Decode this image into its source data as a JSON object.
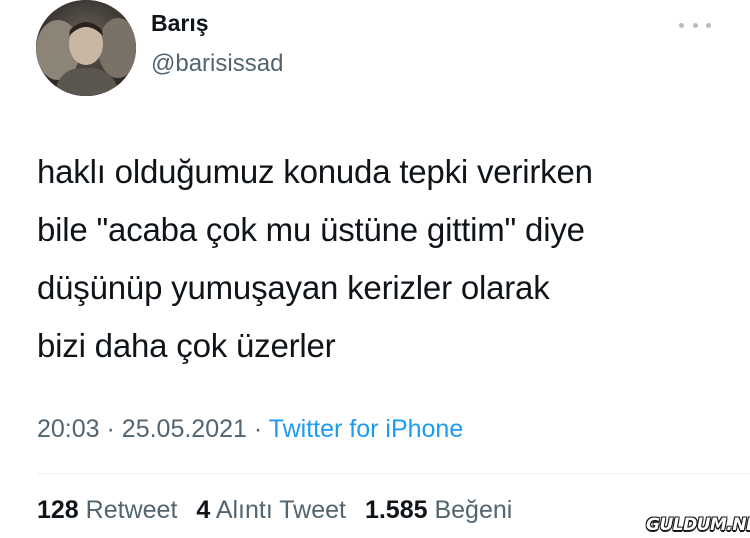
{
  "tweet": {
    "author": {
      "display_name": "Barış",
      "handle": "@barisissad",
      "avatar_icon": "user-photo"
    },
    "more_icon": "ellipsis-icon",
    "text_lines": [
      "haklı olduğumuz konuda tepki verirken",
      "bile \"acaba çok mu üstüne gittim\" diye",
      "düşünüp yumuşayan kerizler olarak",
      "bizi daha çok üzerler"
    ],
    "time": "20:03",
    "date": "25.05.2021",
    "separator": "·",
    "source": "Twitter for iPhone",
    "stats": {
      "retweets_count": "128",
      "retweets_label": "Retweet",
      "quotes_count": "4",
      "quotes_label": "Alıntı Tweet",
      "likes_count": "1.585",
      "likes_label": "Beğeni"
    }
  },
  "watermark": "GULDUM.NET",
  "colors": {
    "text": "#0f1419",
    "secondary": "#536471",
    "link": "#1d9bf0",
    "divider": "#eff3f4"
  }
}
